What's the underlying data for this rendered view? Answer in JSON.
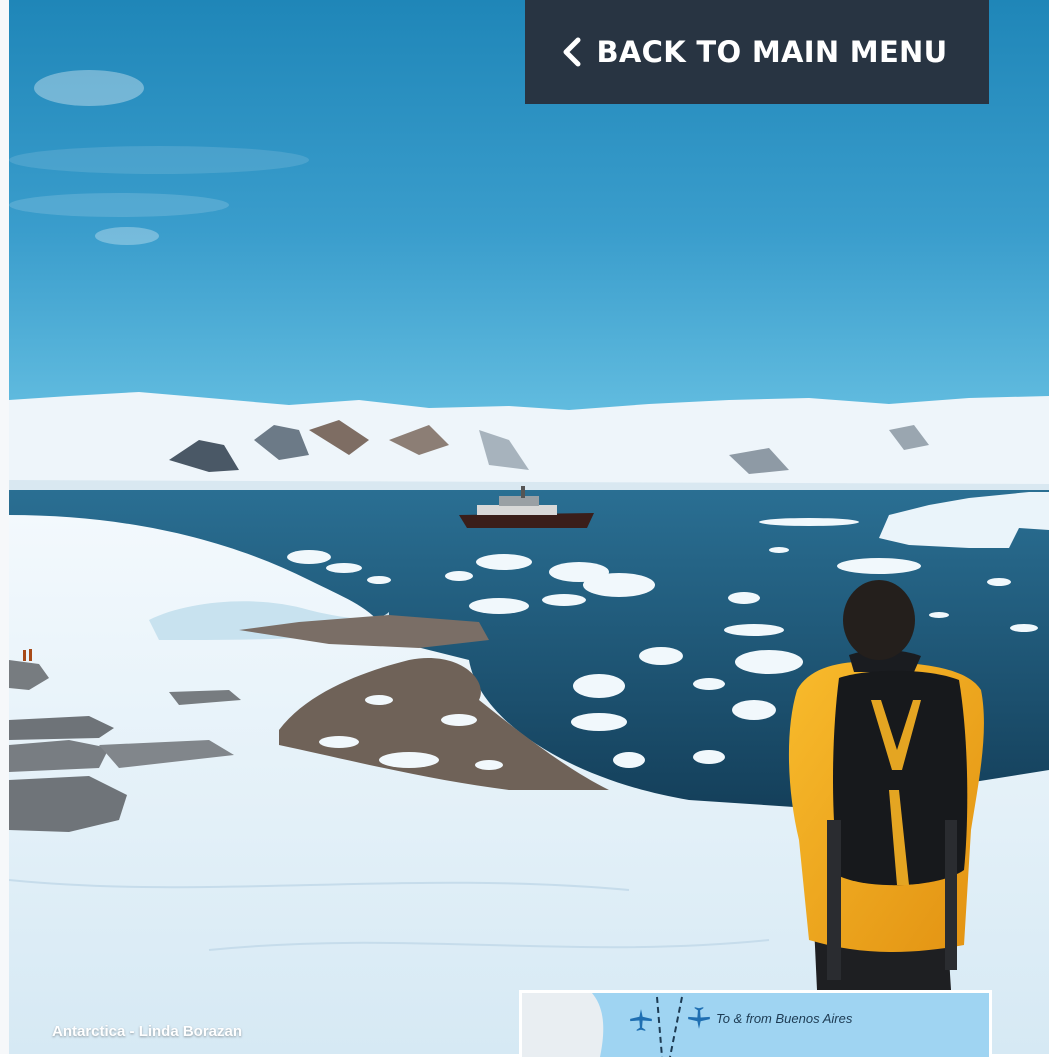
{
  "navigation": {
    "back_button": {
      "label": "BACK TO MAIN MENU",
      "icon": "chevron-left-icon"
    }
  },
  "photo": {
    "caption": "Antarctica - Linda Borazan"
  },
  "map_inset": {
    "route_label": "To & from Buenos Aires",
    "icons": [
      "plane-icon",
      "plane-icon"
    ]
  },
  "colors": {
    "button_bg": "#283442",
    "button_text": "#ffffff",
    "sky": "#3e9fcc",
    "water": "#1f5d80",
    "map_sea": "#9fd4f2",
    "jacket": "#f2a71c"
  }
}
